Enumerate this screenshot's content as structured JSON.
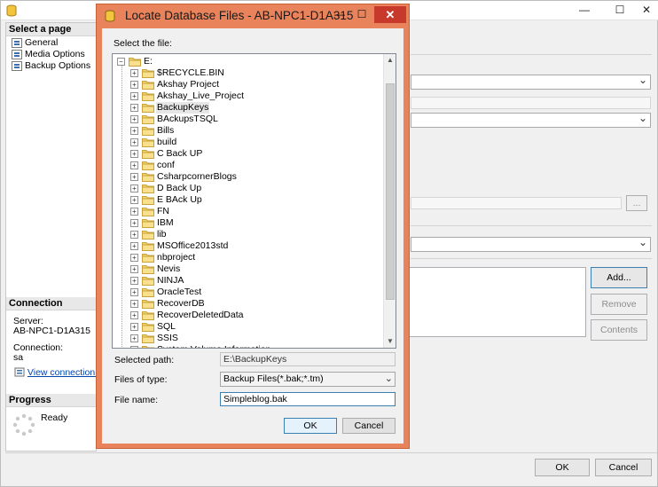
{
  "background_window": {
    "title_controls": {
      "minimize": "—",
      "maximize": "☐",
      "close": "✕"
    },
    "sidebar": {
      "select_page_header": "Select a page",
      "pages": [
        {
          "label": "General"
        },
        {
          "label": "Media Options"
        },
        {
          "label": "Backup Options"
        }
      ],
      "connection_header": "Connection",
      "server_label": "Server:",
      "server_value": "AB-NPC1-D1A315",
      "connection_label": "Connection:",
      "connection_value": "sa",
      "view_connection_link": "View connection pro",
      "progress_header": "Progress",
      "progress_status": "Ready"
    },
    "browse_button": "...",
    "add_button": "Add...",
    "remove_button": "Remove",
    "contents_button": "Contents",
    "ok_button": "OK",
    "cancel_button": "Cancel"
  },
  "dialog": {
    "title": "Locate Database Files - AB-NPC1-D1A315",
    "title_controls": {
      "minimize": "—",
      "maximize": "☐",
      "close": "✕"
    },
    "select_file_label": "Select the file:",
    "tree": {
      "root": "E:",
      "folders": [
        "$RECYCLE.BIN",
        "Akshay Project",
        "Akshay_Live_Project",
        "BackupKeys",
        "BAckupsTSQL",
        "Bills",
        "build",
        "C Back UP",
        "conf",
        "CsharpcornerBlogs",
        "D Back Up",
        "E BAck Up",
        "FN",
        "IBM",
        "lib",
        "MSOffice2013std",
        "nbproject",
        "Nevis",
        "NINJA",
        "OracleTest",
        "RecoverDB",
        "RecoverDeletedData",
        "SQL",
        "SSIS",
        "System Volume Information"
      ],
      "selected_folder": "BackupKeys",
      "scroll_up": "▲",
      "scroll_down": "▼"
    },
    "selected_path_label": "Selected path:",
    "selected_path_value": "E:\\BackupKeys",
    "files_of_type_label": "Files of type:",
    "files_of_type_value": "Backup Files(*.bak;*.tm)",
    "file_name_label": "File name:",
    "file_name_value": "Simpleblog.bak",
    "ok_button": "OK",
    "cancel_button": "Cancel"
  },
  "colors": {
    "dialog_frame": "#e8835b",
    "close_button": "#c7392b",
    "folder": "#f4d36b",
    "focus_border": "#3c7fb1"
  },
  "icons": {
    "app": "database-cylinder-icon",
    "folder": "folder-icon",
    "expander": "plus-expander-icon",
    "spinner": "progress-spinner-icon"
  }
}
